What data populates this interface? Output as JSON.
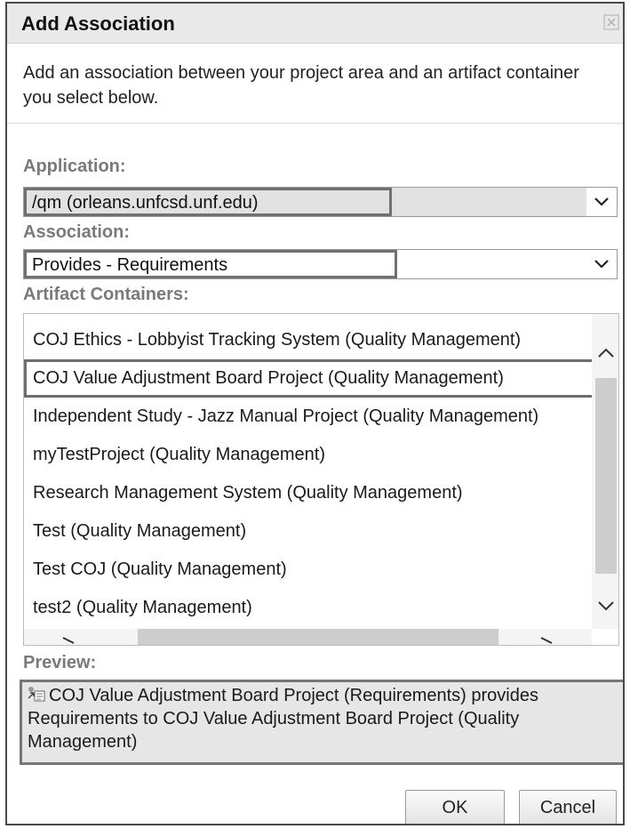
{
  "dialog": {
    "title": "Add Association",
    "description": "Add an association between your project area and an artifact container you select below.",
    "close_icon": "close-icon"
  },
  "application": {
    "label": "Application:",
    "value": "/qm (orleans.unfcsd.unf.edu)"
  },
  "association": {
    "label": "Association:",
    "value": "Provides - Requirements"
  },
  "artifact_containers": {
    "label": "Artifact Containers:",
    "items": [
      "COJ Ethics - Lobbyist Tracking System (Quality Management)",
      "COJ Value Adjustment Board Project (Quality Management)",
      "Independent Study - Jazz Manual Project (Quality Management)",
      "myTestProject (Quality Management)",
      "Research Management System (Quality Management)",
      "Test (Quality Management)",
      "Test COJ (Quality Management)",
      "test2 (Quality Management)"
    ],
    "selected_index": 1
  },
  "preview": {
    "label": "Preview:",
    "text": "COJ Value Adjustment Board Project (Requirements) provides Requirements to COJ Value Adjustment Board Project (Quality Management)",
    "icon": "association-icon"
  },
  "buttons": {
    "ok": "OK",
    "cancel": "Cancel"
  }
}
